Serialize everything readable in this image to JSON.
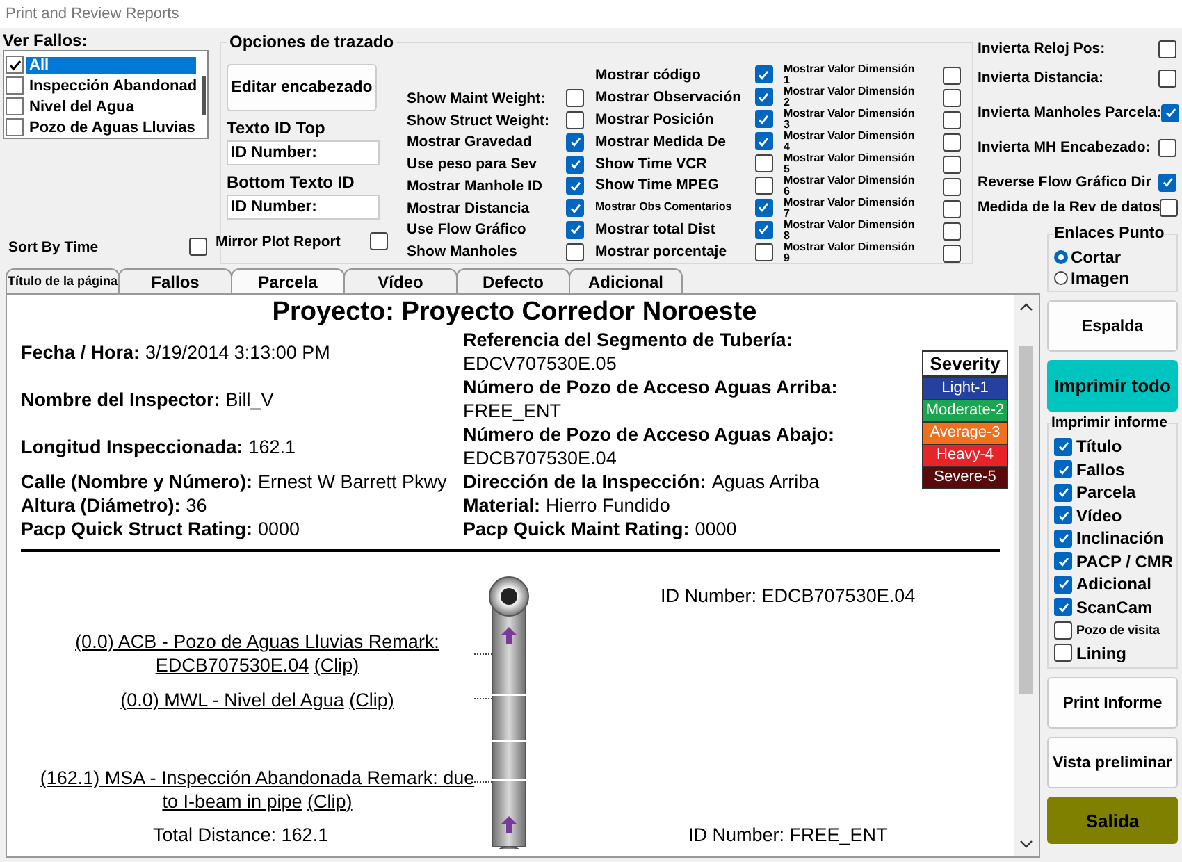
{
  "window": {
    "title": "Print and Review Reports"
  },
  "fault_filter": {
    "label": "Ver Fallos:",
    "items": [
      {
        "label": "All",
        "checked": true,
        "selected": true
      },
      {
        "label": "Inspección Abandonad",
        "checked": false,
        "selected": false
      },
      {
        "label": "Nivel del Agua",
        "checked": false,
        "selected": false
      },
      {
        "label": "Pozo de Aguas Lluvias",
        "checked": false,
        "selected": false
      }
    ]
  },
  "sort_by_time": {
    "label": "Sort By Time",
    "checked": false
  },
  "plot_options": {
    "title": "Opciones de trazado",
    "edit_header_button": "Editar encabezado",
    "top_id": {
      "label": "Texto ID Top",
      "value": "ID Number:"
    },
    "bottom_id": {
      "label": "Bottom Texto ID",
      "value": "ID Number:"
    },
    "mirror": {
      "label": "Mirror Plot Report",
      "checked": false
    },
    "column_1": [
      {
        "label": "Show Maint Weight:",
        "checked": false
      },
      {
        "label": "Show Struct Weight:",
        "checked": false
      },
      {
        "label": "Mostrar Gravedad",
        "checked": true
      },
      {
        "label": "Use peso para Sev",
        "checked": true
      },
      {
        "label": "Mostrar Manhole ID",
        "checked": true
      },
      {
        "label": "Mostrar Distancia",
        "checked": true
      },
      {
        "label": "Use Flow Gráfico",
        "checked": true
      },
      {
        "label": "Show Manholes",
        "checked": false
      }
    ],
    "column_2": [
      {
        "label": "Mostrar código",
        "checked": true
      },
      {
        "label": "Mostrar Observación",
        "checked": true
      },
      {
        "label": "Mostrar Posición",
        "checked": true
      },
      {
        "label": "Mostrar Medida De",
        "checked": true
      },
      {
        "label": "Show Time VCR",
        "checked": false
      },
      {
        "label": "Show Time MPEG",
        "checked": false
      },
      {
        "label": "Mostrar Obs Comentarios",
        "checked": true
      },
      {
        "label": "Mostrar total Dist",
        "checked": true
      },
      {
        "label": "Mostrar porcentaje",
        "checked": false
      }
    ],
    "column_3": [
      {
        "label": "Mostrar Valor Dimensión 1",
        "checked": false
      },
      {
        "label": "Mostrar Valor Dimensión 2",
        "checked": false
      },
      {
        "label": "Mostrar Valor Dimensión 3",
        "checked": false
      },
      {
        "label": "Mostrar Valor Dimensión 4",
        "checked": false
      },
      {
        "label": "Mostrar Valor Dimensión 5",
        "checked": false
      },
      {
        "label": "Mostrar Valor Dimensión 6",
        "checked": false
      },
      {
        "label": "Mostrar Valor Dimensión 7",
        "checked": false
      },
      {
        "label": "Mostrar Valor Dimensión 8",
        "checked": false
      },
      {
        "label": "Mostrar Valor Dimensión 9",
        "checked": false
      }
    ]
  },
  "side_options": [
    {
      "label": "Invierta Reloj Pos:",
      "checked": false
    },
    {
      "label": "Invierta Distancia:",
      "checked": false
    },
    {
      "label": "Invierta Manholes Parcela:",
      "checked": true
    },
    {
      "label": "Invierta MH Encabezado:",
      "checked": false
    },
    {
      "label": "Reverse Flow Gráfico Dir",
      "checked": true
    },
    {
      "label": "Medida de la Rev de datos",
      "checked": false
    }
  ],
  "point_links": {
    "title": "Enlaces Punto",
    "options": [
      {
        "label": "Cortar",
        "selected": true
      },
      {
        "label": "Imagen",
        "selected": false
      }
    ]
  },
  "tabs": [
    {
      "label": "Título de la página",
      "selected": false
    },
    {
      "label": "Fallos",
      "selected": false
    },
    {
      "label": "Parcela",
      "selected": true
    },
    {
      "label": "Vídeo",
      "selected": false
    },
    {
      "label": "Defecto",
      "selected": false
    },
    {
      "label": "Adicional",
      "selected": false
    }
  ],
  "report": {
    "title": "Proyecto: Proyecto Corredor Noroeste",
    "details": [
      {
        "left": {
          "label": "Fecha / Hora:",
          "value": "3/19/2014 3:13:00 PM",
          "kind": "inline"
        },
        "right": {
          "label": "Referencia del Segmento de Tubería:",
          "value": "EDCV707530E.05",
          "kind": "stacked"
        }
      },
      {
        "left": {
          "label": "Nombre del Inspector:",
          "value": "Bill_V",
          "kind": "inline"
        },
        "right": {
          "label": "Número de Pozo de Acceso Aguas Arriba:",
          "value": "FREE_ENT",
          "kind": "stacked"
        }
      },
      {
        "left": {
          "label": "Longitud Inspeccionada:",
          "value": "162.1",
          "kind": "inline"
        },
        "right": {
          "label": "Número de Pozo de Acceso Aguas Abajo:",
          "value": "EDCB707530E.04",
          "kind": "stacked"
        }
      },
      {
        "left": {
          "label": "Calle (Nombre y Número):",
          "value": "Ernest W Barrett Pkwy",
          "kind": "inline"
        },
        "right": {
          "label": "Dirección de la Inspección:",
          "value": "Aguas Arriba",
          "kind": "inline"
        }
      },
      {
        "left": {
          "label": "Altura (Diámetro):",
          "value": "36",
          "kind": "inline"
        },
        "right": {
          "label": "Material:",
          "value": "Hierro Fundido",
          "kind": "inline"
        }
      },
      {
        "left": {
          "label": "Pacp Quick Struct Rating:",
          "value": "0000",
          "kind": "inline"
        },
        "right": {
          "label": "Pacp Quick Maint Rating:",
          "value": "0000",
          "kind": "inline"
        }
      }
    ],
    "severity": {
      "title": "Severity",
      "levels": [
        {
          "label": "Light-1",
          "color": "#2541a0"
        },
        {
          "label": "Moderate-2",
          "color": "#1aa650"
        },
        {
          "label": "Average-3",
          "color": "#f0701e"
        },
        {
          "label": "Heavy-4",
          "color": "#e8232a"
        },
        {
          "label": "Severe-5",
          "color": "#5a0a0a"
        }
      ]
    },
    "plot": {
      "top_id": "ID Number: EDCB707530E.04",
      "bottom_id": "ID Number: FREE_ENT",
      "total_distance": "Total Distance: 162.1",
      "remarks": [
        {
          "text": "(0.0) ACB - Pozo de Aguas Lluvias Remark: EDCB707530E.04",
          "clip": "(Clip)"
        },
        {
          "text": "(0.0) MWL - Nivel del Agua",
          "clip": "(Clip)"
        },
        {
          "text": "(162.1) MSA - Inspección Abandonada Remark: due to I-beam in pipe",
          "clip": "(Clip)"
        }
      ]
    }
  },
  "actions": {
    "back": "Espalda",
    "print_all": "Imprimir todo",
    "print_group": {
      "title": "Imprimir informe",
      "items": [
        {
          "label": "Título",
          "checked": true
        },
        {
          "label": "Fallos",
          "checked": true
        },
        {
          "label": "Parcela",
          "checked": true
        },
        {
          "label": "Vídeo",
          "checked": true
        },
        {
          "label": "Inclinación",
          "checked": true
        },
        {
          "label": "PACP / CMR",
          "checked": true
        },
        {
          "label": "Adicional",
          "checked": true
        },
        {
          "label": "ScanCam",
          "checked": true
        },
        {
          "label": "Pozo de visita",
          "checked": false
        },
        {
          "label": "Lining",
          "checked": false
        }
      ]
    },
    "print_report": "Print Informe",
    "preview": "Vista preliminar",
    "exit": "Salida"
  }
}
